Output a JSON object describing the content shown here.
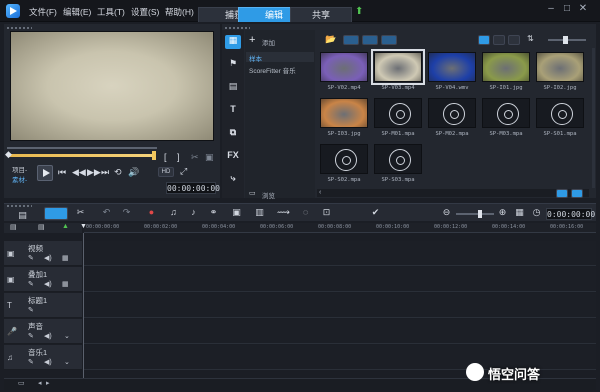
{
  "titlebar": {
    "menu": [
      "文件(F)",
      "编辑(E)",
      "工具(T)",
      "设置(S)",
      "帮助(H)"
    ],
    "tabs": [
      "捕获",
      "编辑",
      "共享"
    ]
  },
  "preview": {
    "labels": {
      "project": "项目-",
      "clip": "素材-"
    },
    "timecode": "00:00:00:00",
    "hd_label": "HD"
  },
  "library": {
    "sidebar_icons": [
      "media-icon",
      "instant-project-icon",
      "title-icon",
      "transition-icon",
      "filter-icon",
      "fx",
      "motion-path-icon"
    ],
    "fx_label": "FX",
    "add_label": "添加",
    "folders": [
      "样本",
      "ScoreFitter 音乐"
    ],
    "browse_label": "浏览",
    "thumbnails": [
      {
        "name": "SP-V02.mp4",
        "kind": "video",
        "color": "#7a5fb8"
      },
      {
        "name": "SP-V03.mp4",
        "kind": "video",
        "color": "#cfc9b4",
        "selected": true
      },
      {
        "name": "SP-V04.wmv",
        "kind": "video",
        "color": "#1d3fa8"
      },
      {
        "name": "SP-I01.jpg",
        "kind": "image",
        "color": "#8a9a4a"
      },
      {
        "name": "SP-I02.jpg",
        "kind": "image",
        "color": "#a9a077"
      },
      {
        "name": "SP-I03.jpg",
        "kind": "image",
        "color": "#c98447"
      },
      {
        "name": "SP-M01.mpa",
        "kind": "audio"
      },
      {
        "name": "SP-M02.mpa",
        "kind": "audio"
      },
      {
        "name": "SP-M03.mpa",
        "kind": "audio"
      },
      {
        "name": "SP-S01.mpa",
        "kind": "audio"
      },
      {
        "name": "SP-S02.mpa",
        "kind": "audio"
      },
      {
        "name": "SP-S03.mpa",
        "kind": "audio"
      }
    ]
  },
  "timeline": {
    "timecode": "0:00:00:00",
    "ruler": [
      "00:00:00:00",
      "00:00:02:00",
      "00:00:04:00",
      "00:00:06:00",
      "00:00:08:00",
      "00:00:10:00",
      "00:00:12:00",
      "00:00:14:00",
      "00:00:16:00"
    ],
    "tracks": [
      {
        "name": "视频",
        "icon": "video-track-icon"
      },
      {
        "name": "叠加1",
        "icon": "overlay-track-icon"
      },
      {
        "name": "标题1",
        "icon": "title-track-icon"
      },
      {
        "name": "声音",
        "icon": "voice-track-icon"
      },
      {
        "name": "音乐1",
        "icon": "music-track-icon"
      }
    ]
  },
  "watermark": "悟空问答"
}
